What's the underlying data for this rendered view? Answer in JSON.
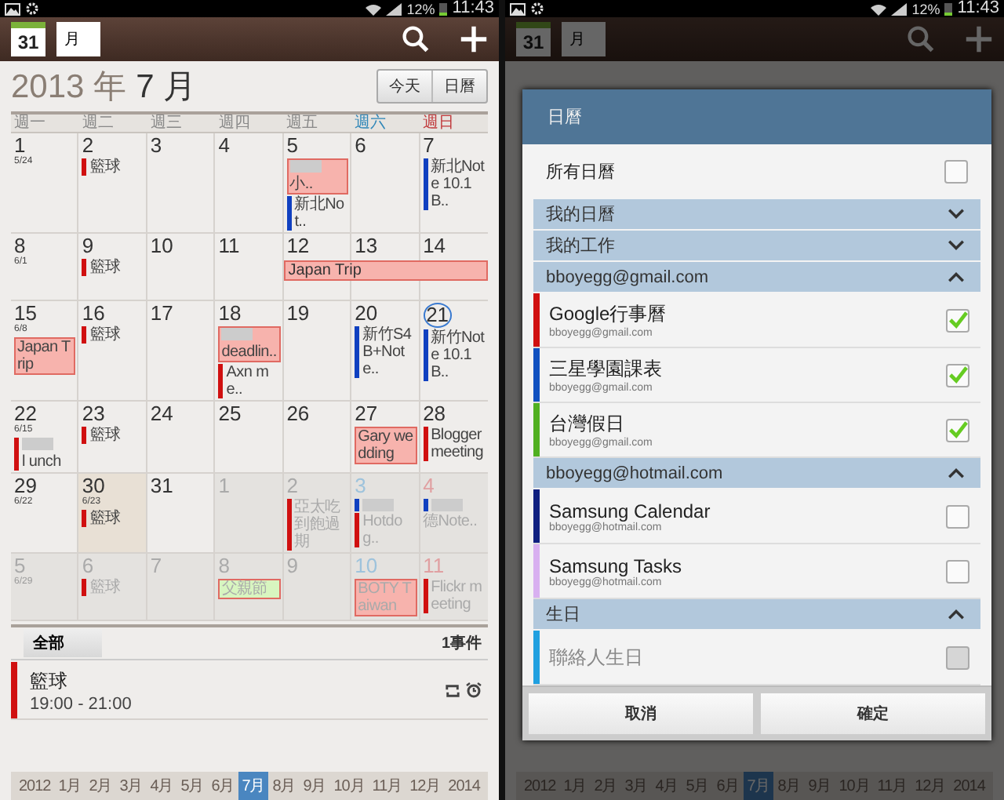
{
  "left_screen": {
    "status_bar": {
      "battery": "12%",
      "time": "11:43"
    },
    "app_bar": {
      "date_icon": "31",
      "view": "月"
    },
    "header": {
      "year": "2013 年",
      "month": "7 月",
      "buttons": [
        {
          "label": "今天"
        },
        {
          "label": "日曆"
        }
      ]
    },
    "weekdays": [
      {
        "label": "週一",
        "kind": "weekday"
      },
      {
        "label": "週二",
        "kind": "weekday"
      },
      {
        "label": "週三",
        "kind": "weekday"
      },
      {
        "label": "週四",
        "kind": "weekday"
      },
      {
        "label": "週五",
        "kind": "weekday"
      },
      {
        "label": "週六",
        "kind": "saturday"
      },
      {
        "label": "週日",
        "kind": "sunday"
      }
    ],
    "weeks": [
      {
        "days": [
          {
            "day": "1",
            "lunar": "5/24",
            "kind": "current"
          },
          {
            "day": "2",
            "kind": "current",
            "events": [
              {
                "kind": "bar",
                "title": "籃球",
                "color": "#d01010"
              }
            ]
          },
          {
            "day": "3",
            "kind": "current"
          },
          {
            "day": "4",
            "kind": "current"
          },
          {
            "day": "5",
            "kind": "current",
            "events": [
              {
                "kind": "block",
                "title": "小..",
                "color": "#f7b3ad",
                "blurred": true
              },
              {
                "kind": "bar",
                "title": "新北Not..",
                "color": "#1040c0"
              }
            ]
          },
          {
            "day": "6",
            "kind": "current"
          },
          {
            "day": "7",
            "kind": "current",
            "events": [
              {
                "kind": "bar",
                "title": "新北Note 10.1 B..",
                "color": "#1040c0"
              }
            ]
          }
        ]
      },
      {
        "days": [
          {
            "day": "8",
            "lunar": "6/1",
            "kind": "current"
          },
          {
            "day": "9",
            "kind": "current",
            "events": [
              {
                "kind": "bar",
                "title": "籃球",
                "color": "#d01010"
              }
            ]
          },
          {
            "day": "10",
            "kind": "current"
          },
          {
            "day": "11",
            "kind": "current"
          },
          {
            "day": "12",
            "kind": "current",
            "events": [
              {
                "kind": "span",
                "title": "Japan Trip",
                "color": "#f7b3ad"
              }
            ]
          },
          {
            "day": "13",
            "kind": "current",
            "events": [
              {
                "kind": "span-cont",
                "color": "#f7b3ad"
              }
            ]
          },
          {
            "day": "14",
            "kind": "current",
            "events": [
              {
                "kind": "span-cont",
                "color": "#f7b3ad"
              }
            ]
          }
        ]
      },
      {
        "days": [
          {
            "day": "15",
            "lunar": "6/8",
            "kind": "current",
            "events": [
              {
                "kind": "block",
                "title": "Japan Trip",
                "color": "#f7b3ad"
              }
            ]
          },
          {
            "day": "16",
            "kind": "current",
            "events": [
              {
                "kind": "bar",
                "title": "籃球",
                "color": "#d01010"
              }
            ]
          },
          {
            "day": "17",
            "kind": "current"
          },
          {
            "day": "18",
            "kind": "current",
            "events": [
              {
                "kind": "block",
                "title": "deadlin..",
                "color": "#f7b3ad",
                "blurred": true
              },
              {
                "kind": "bar",
                "title": "Axn me..",
                "color": "#d01010"
              }
            ]
          },
          {
            "day": "19",
            "kind": "current"
          },
          {
            "day": "20",
            "kind": "current",
            "events": [
              {
                "kind": "bar",
                "title": "新竹S4 B+Note..",
                "color": "#1040c0"
              }
            ]
          },
          {
            "day": "21",
            "kind": "current",
            "today": true,
            "events": [
              {
                "kind": "bar",
                "title": "新竹Note 10.1 B..",
                "color": "#1040c0"
              }
            ]
          }
        ]
      },
      {
        "days": [
          {
            "day": "22",
            "lunar": "6/15",
            "kind": "current",
            "events": [
              {
                "kind": "bar",
                "title": "l unch",
                "color": "#d01010",
                "blurred": true
              }
            ]
          },
          {
            "day": "23",
            "kind": "current",
            "events": [
              {
                "kind": "bar",
                "title": "籃球",
                "color": "#d01010"
              }
            ]
          },
          {
            "day": "24",
            "kind": "current"
          },
          {
            "day": "25",
            "kind": "current"
          },
          {
            "day": "26",
            "kind": "current"
          },
          {
            "day": "27",
            "kind": "current",
            "events": [
              {
                "kind": "block",
                "title": "Gary wedding",
                "color": "#f7b3ad"
              }
            ]
          },
          {
            "day": "28",
            "kind": "current",
            "events": [
              {
                "kind": "bar",
                "title": "Blogger meeting",
                "color": "#d01010"
              }
            ]
          }
        ]
      },
      {
        "days": [
          {
            "day": "29",
            "lunar": "6/22",
            "kind": "current"
          },
          {
            "day": "30",
            "lunar": "6/23",
            "kind": "current",
            "selected": true,
            "events": [
              {
                "kind": "bar",
                "title": "籃球",
                "color": "#d01010"
              }
            ]
          },
          {
            "day": "31",
            "kind": "current"
          },
          {
            "day": "1",
            "kind": "other"
          },
          {
            "day": "2",
            "kind": "other",
            "events": [
              {
                "kind": "bar",
                "title": "亞太吃到飽過期",
                "color": "#d01010"
              }
            ]
          },
          {
            "day": "3",
            "kind": "other",
            "events": [
              {
                "kind": "bar",
                "color": "#1040c0",
                "blurred": true
              },
              {
                "kind": "bar",
                "title": "Hotdog..",
                "color": "#d01010"
              }
            ]
          },
          {
            "day": "4",
            "kind": "other",
            "events": [
              {
                "kind": "bar",
                "color": "#1040c0",
                "blurred": true
              },
              {
                "kind": "text",
                "title": "德Note.."
              }
            ]
          }
        ]
      },
      {
        "days": [
          {
            "day": "5",
            "lunar": "6/29",
            "kind": "other"
          },
          {
            "day": "6",
            "kind": "other",
            "events": [
              {
                "kind": "bar",
                "title": "籃球",
                "color": "#d01010"
              }
            ]
          },
          {
            "day": "7",
            "kind": "other"
          },
          {
            "day": "8",
            "kind": "other",
            "events": [
              {
                "kind": "block",
                "title": "父親節",
                "color": "#d8f5c0"
              }
            ]
          },
          {
            "day": "9",
            "kind": "other"
          },
          {
            "day": "10",
            "kind": "other",
            "events": [
              {
                "kind": "block",
                "title": "BOTY Taiwan",
                "color": "#f7b3ad"
              }
            ]
          },
          {
            "day": "11",
            "kind": "other",
            "events": [
              {
                "kind": "bar",
                "title": "Flickr meeting",
                "color": "#d01010"
              }
            ]
          }
        ]
      }
    ],
    "filter": {
      "label": "全部"
    },
    "event_count": "1事件",
    "events": [
      {
        "title": "籃球",
        "time": "19:00 - 21:00",
        "color": "#d01010",
        "repeat": true,
        "alarm": true
      }
    ],
    "month_strip": [
      {
        "label": "2012",
        "selected": false
      },
      {
        "label": "1月",
        "selected": false
      },
      {
        "label": "2月",
        "selected": false
      },
      {
        "label": "3月",
        "selected": false
      },
      {
        "label": "4月",
        "selected": false
      },
      {
        "label": "5月",
        "selected": false
      },
      {
        "label": "6月",
        "selected": false
      },
      {
        "label": "7月",
        "selected": true
      },
      {
        "label": "8月",
        "selected": false
      },
      {
        "label": "9月",
        "selected": false
      },
      {
        "label": "10月",
        "selected": false
      },
      {
        "label": "11月",
        "selected": false
      },
      {
        "label": "12月",
        "selected": false
      },
      {
        "label": "2014",
        "selected": false
      }
    ]
  },
  "right_screen": {
    "status_bar": {
      "battery": "12%",
      "time": "11:43"
    },
    "app_bar": {
      "date_icon": "31",
      "view": "月"
    },
    "dialog": {
      "title": "日曆",
      "all": {
        "label": "所有日曆",
        "checked": false
      },
      "groups": [
        {
          "title": "我的日曆",
          "expanded": false
        },
        {
          "title": "我的工作",
          "expanded": false
        },
        {
          "title": "bboyegg@gmail.com",
          "expanded": true,
          "items": [
            {
              "name": "Google行事曆",
              "account": "bboyegg@gmail.com",
              "color": "#d01010",
              "checked": true,
              "disabled": false
            },
            {
              "name": "三星學園課表",
              "account": "bboyegg@gmail.com",
              "color": "#1050c0",
              "checked": true,
              "disabled": false
            },
            {
              "name": "台灣假日",
              "account": "bboyegg@gmail.com",
              "color": "#50b020",
              "checked": true,
              "disabled": false
            }
          ]
        },
        {
          "title": "bboyegg@hotmail.com",
          "expanded": true,
          "items": [
            {
              "name": "Samsung Calendar",
              "account": "bboyegg@hotmail.com",
              "color": "#102080",
              "checked": false,
              "disabled": false
            },
            {
              "name": "Samsung Tasks",
              "account": "bboyegg@hotmail.com",
              "color": "#d8b0f0",
              "checked": false,
              "disabled": false
            }
          ]
        },
        {
          "title": "生日",
          "expanded": true,
          "items": [
            {
              "name": "聯絡人生日",
              "color": "#20a0e0",
              "checked": false,
              "disabled": true
            }
          ]
        }
      ],
      "buttons": [
        {
          "label": "取消"
        },
        {
          "label": "確定"
        }
      ]
    },
    "month_strip": [
      {
        "label": "2012",
        "selected": false
      },
      {
        "label": "1月",
        "selected": false
      },
      {
        "label": "2月",
        "selected": false
      },
      {
        "label": "3月",
        "selected": false
      },
      {
        "label": "4月",
        "selected": false
      },
      {
        "label": "5月",
        "selected": false
      },
      {
        "label": "6月",
        "selected": false
      },
      {
        "label": "7月",
        "selected": true
      },
      {
        "label": "8月",
        "selected": false
      },
      {
        "label": "9月",
        "selected": false
      },
      {
        "label": "10月",
        "selected": false
      },
      {
        "label": "11月",
        "selected": false
      },
      {
        "label": "12月",
        "selected": false
      },
      {
        "label": "2014",
        "selected": false
      }
    ]
  }
}
